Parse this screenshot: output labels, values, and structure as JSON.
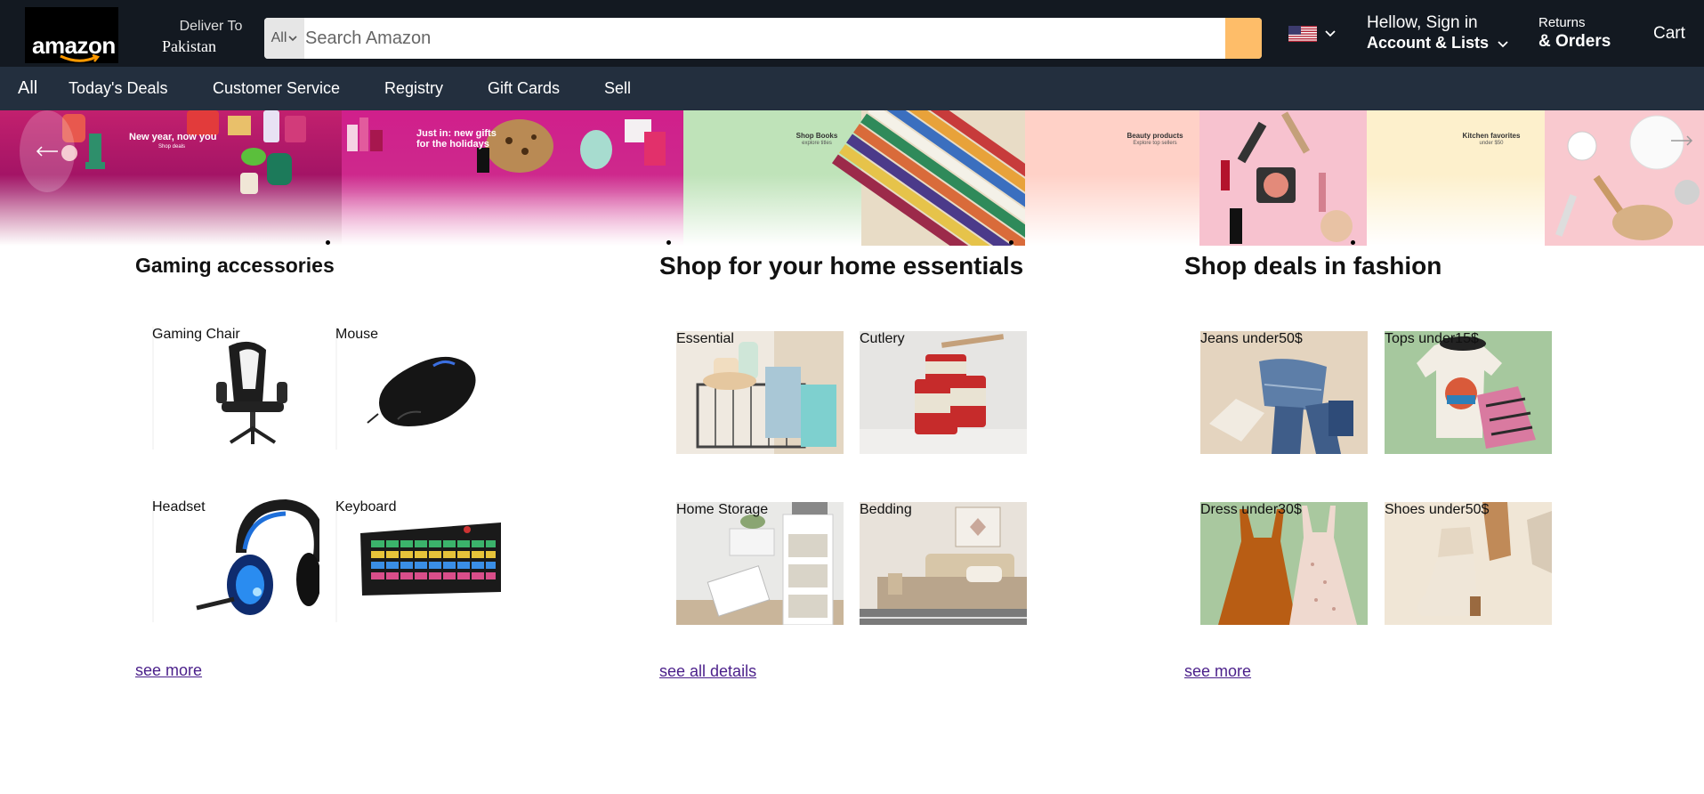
{
  "header": {
    "logo_text": "amazon",
    "deliver_label": "Deliver To",
    "deliver_country": "Pakistan",
    "search_category": "All",
    "search_placeholder": "Search Amazon",
    "greeting": "Hellow, Sign in",
    "account_label": "Account & Lists",
    "returns_label": "Returns",
    "orders_label": "& Orders",
    "cart_label": "Cart"
  },
  "nav": {
    "items": [
      "All",
      "Today's Deals",
      "Customer Service",
      "Registry",
      "Gift Cards",
      "Sell"
    ]
  },
  "hero": {
    "panels": [
      {
        "headline": "New year, now you",
        "subline": "Shop deals"
      },
      {
        "headline": "Just in: new gifts for the holidays",
        "subline": ""
      },
      {
        "headline": "Shop Books",
        "subline": "explore titles"
      },
      {
        "headline": "Beauty products",
        "subline": "Explore top sellers"
      },
      {
        "headline": "Kitchen favorites",
        "subline": "under $50"
      }
    ]
  },
  "cards": [
    {
      "title": "Gaming accessories",
      "tiles": [
        "Gaming Chair",
        "Mouse",
        "Headset",
        "Keyboard"
      ],
      "link": "see more"
    },
    {
      "title": "Shop for your home essentials",
      "tiles": [
        "Essential",
        "Cutlery",
        "Home Storage",
        "Bedding"
      ],
      "link": "see all details"
    },
    {
      "title": "Shop deals in fashion",
      "tiles": [
        "Jeans under50$",
        "Tops under15$",
        "Dress under30$",
        "Shoes under50$"
      ],
      "link": "see more"
    }
  ],
  "colors": {
    "header_bg": "#131921",
    "nav_bg": "#232f3e",
    "search_button": "#febd69",
    "link": "#4a1f8a"
  }
}
